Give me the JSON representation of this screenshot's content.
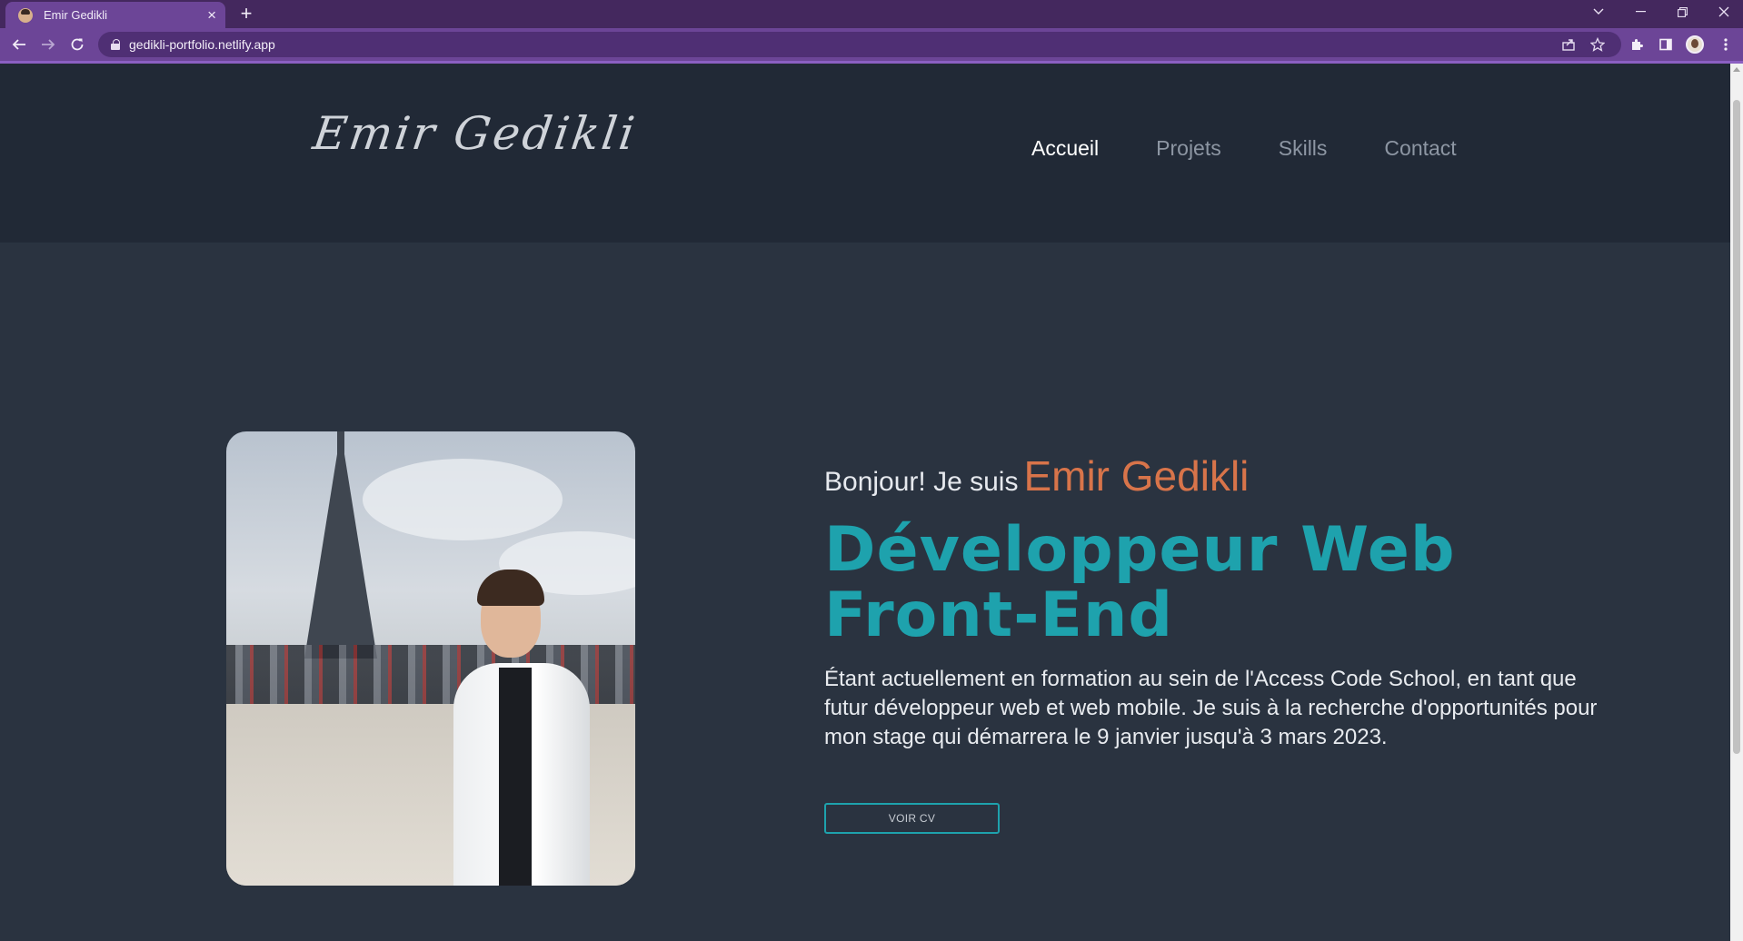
{
  "browser": {
    "tab_title": "Emir Gedikli",
    "tab_close": "×",
    "new_tab": "+",
    "url": "gedikli-portfolio.netlify.app",
    "icons": [
      "favicon-avatar",
      "close-icon",
      "plus-icon",
      "chevron-down-icon",
      "minimize-icon",
      "restore-icon",
      "window-close-icon",
      "back-arrow-icon",
      "forward-arrow-icon",
      "reload-icon",
      "lock-icon",
      "share-icon",
      "star-icon",
      "puzzle-icon",
      "side-panel-icon",
      "profile-avatar",
      "kebab-menu-icon"
    ]
  },
  "header": {
    "logo": "Emir Gedikli",
    "nav": [
      {
        "label": "Accueil",
        "active": true
      },
      {
        "label": "Projets",
        "active": false
      },
      {
        "label": "Skills",
        "active": false
      },
      {
        "label": "Contact",
        "active": false
      }
    ]
  },
  "hero": {
    "intro_prefix": "Bonjour! Je suis",
    "name": "Emir Gedikli",
    "headline_line1": "Développeur Web",
    "headline_line2": "Front-End",
    "bio": "Étant actuellement en formation au sein de l'Access Code School, en tant que futur développeur web et web mobile. Je suis à la recherche d'opportunités pour mon stage qui démarrera le 9 janvier jusqu'à 3 mars 2023.",
    "cv_button": "VOIR CV"
  },
  "colors": {
    "chrome_tabbar": "#44285e",
    "chrome_toolbar": "#6c4597",
    "header_bg": "#212936",
    "page_bg": "#2a3340",
    "accent_teal": "#1ea2ad",
    "accent_orange": "#d8744a",
    "nav_inactive": "#8d96a3"
  }
}
